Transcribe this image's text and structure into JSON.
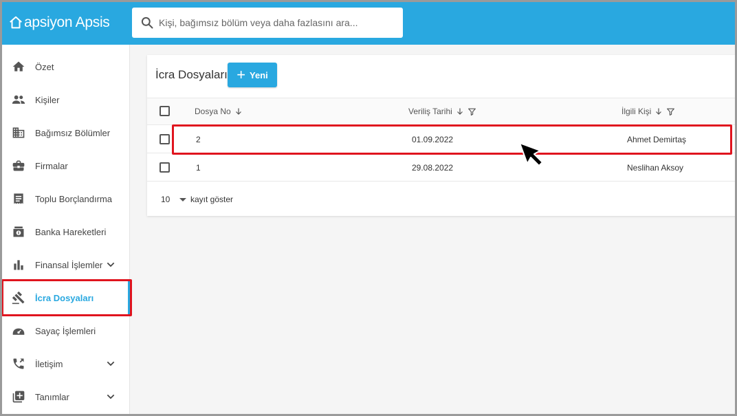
{
  "header": {
    "logo_text": "apsiyon Apsis",
    "search_placeholder": "Kişi, bağımsız bölüm veya daha fazlasını ara...",
    "search_value": ""
  },
  "sidebar": {
    "items": [
      {
        "label": "Özet",
        "icon": "home-icon"
      },
      {
        "label": "Kişiler",
        "icon": "people-icon"
      },
      {
        "label": "Bağımsız Bölümler",
        "icon": "building-icon"
      },
      {
        "label": "Firmalar",
        "icon": "briefcase-icon"
      },
      {
        "label": "Toplu Borçlandırma",
        "icon": "receipt-icon"
      },
      {
        "label": "Banka Hareketleri",
        "icon": "bank-icon"
      },
      {
        "label": "Finansal İşlemler",
        "icon": "bar-chart-icon",
        "expandable": true
      },
      {
        "label": "İcra Dosyaları",
        "icon": "gavel-icon",
        "active": true
      },
      {
        "label": "Sayaç İşlemleri",
        "icon": "meter-icon"
      },
      {
        "label": "İletişim",
        "icon": "phone-icon",
        "expandable": true
      },
      {
        "label": "Tanımlar",
        "icon": "add-box-icon",
        "expandable": true
      }
    ]
  },
  "main": {
    "title": "İcra Dosyaları",
    "new_button_label": "Yeni",
    "columns": [
      {
        "label": "Dosya No",
        "sort": "desc",
        "filter": false
      },
      {
        "label": "Veriliş Tarihi",
        "sort": "desc",
        "filter": true
      },
      {
        "label": "İlgili Kişi",
        "sort": "desc",
        "filter": true
      }
    ],
    "rows": [
      {
        "dosya_no": "2",
        "verilis_tarihi": "01.09.2022",
        "ilgili_kisi": "Ahmet Demirtaş",
        "highlighted": true
      },
      {
        "dosya_no": "1",
        "verilis_tarihi": "29.08.2022",
        "ilgili_kisi": "Neslihan Aksoy",
        "highlighted": false
      }
    ],
    "pagination": {
      "page_size": "10",
      "page_size_label": "kayıt göster"
    }
  },
  "colors": {
    "accent": "#29a8e0",
    "highlight_border": "#e0141e",
    "sidebar_icon": "#555555"
  }
}
